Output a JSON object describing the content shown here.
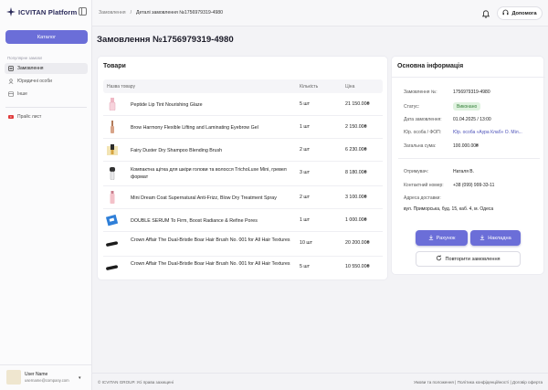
{
  "app": {
    "brand": "ICVITAN Platform"
  },
  "sidebar": {
    "catalog_label": "Каталог",
    "section_title": "Популярне замовл",
    "items": [
      {
        "label": "Замовлення",
        "icon": "orders-icon",
        "active": true
      },
      {
        "label": "Юридичні особи",
        "icon": "legal-entities-icon",
        "active": false
      },
      {
        "label": "Інше",
        "icon": "other-icon",
        "active": false
      }
    ],
    "price_list_label": "Прайс лист"
  },
  "user": {
    "name": "User Name",
    "email": "username@company.com"
  },
  "header": {
    "breadcrumb_root": "Замовлення",
    "breadcrumb_sep": "/",
    "breadcrumb_current": "Деталі замовлення №1756979319-4980",
    "help_label": "Допомога"
  },
  "page": {
    "title": "Замовлення №1756979319-4980"
  },
  "goods": {
    "title": "Товари",
    "columns": {
      "name": "Назва товару",
      "qty": "Кількість",
      "price": "Ціна"
    },
    "rows": [
      {
        "name": "Peptide Lip Tint Nourishing Glaze",
        "qty": "5 шт",
        "price": "21 150.00₴"
      },
      {
        "name": "Brow Harmony Flexible Lifting and Laminating Eyebrow Gel",
        "qty": "1 шт",
        "price": "2 150.00₴"
      },
      {
        "name": "Fairy Duster Dry Shampoo Blending Brush",
        "qty": "2 шт",
        "price": "6 230.00₴"
      },
      {
        "name": "Компактна щітка для шкіри голови та волосся TrichoLuxe Mini, гревел формат",
        "qty": "3 шт",
        "price": "8 180.00₴"
      },
      {
        "name": "Mini Dream Coat Supernatural Anti-Frizz, Blow Dry Treatment Spray",
        "qty": "2 шт",
        "price": "3 100.00₴"
      },
      {
        "name": "DOUBLE SERUM To Firm, Boost Radiance & Refine Pores",
        "qty": "1 шт",
        "price": "1 000.00₴"
      },
      {
        "name": "Crown Affair The Dual-Bristle Boar Hair Brush No. 001 for All Hair Textures",
        "qty": "10 шт",
        "price": "20 200.00₴"
      },
      {
        "name": "Crown Affair The Dual-Bristle Boar Hair Brush No. 001 for All Hair Textures",
        "qty": "5 шт",
        "price": "10 550.00₴"
      }
    ]
  },
  "info": {
    "title": "Основна інформація",
    "order_label": "Замовлення №:",
    "order_value": "1756979319-4980",
    "status_label": "Статус:",
    "status_value": "Виконано",
    "created_label": "Дата замовлення:",
    "created_value": "01.04.2025 / 13:00",
    "entity_label": "Юр. особа / ФОП:",
    "entity_value": "Юр. особа «Аура Клаб» О. Міл...",
    "total_label": "Загальна сума:",
    "total_value": "100.000.00₴",
    "recipient_label": "Отримувач:",
    "recipient_value": "Наталя В.",
    "phone_label": "Контактний номер:",
    "phone_value": "+38 (099) 999-33-11",
    "address_label": "Адреса доставки:",
    "address_value": "вул. Приморська, буд. 15, каб. 4, м. Одеса",
    "invoice_label": "Рахунок",
    "waybill_label": "Накладна",
    "repeat_label": "Повторити замовлення"
  },
  "footer": {
    "copyright": "© ICVITAN GROUP. Усі права захищені",
    "legal": "Умови та положення | Політика конфіденційності | Договір оферта"
  },
  "colors": {
    "accent": "#6b6ed8",
    "status_bg": "#dff2df",
    "status_text": "#2f7d34"
  }
}
